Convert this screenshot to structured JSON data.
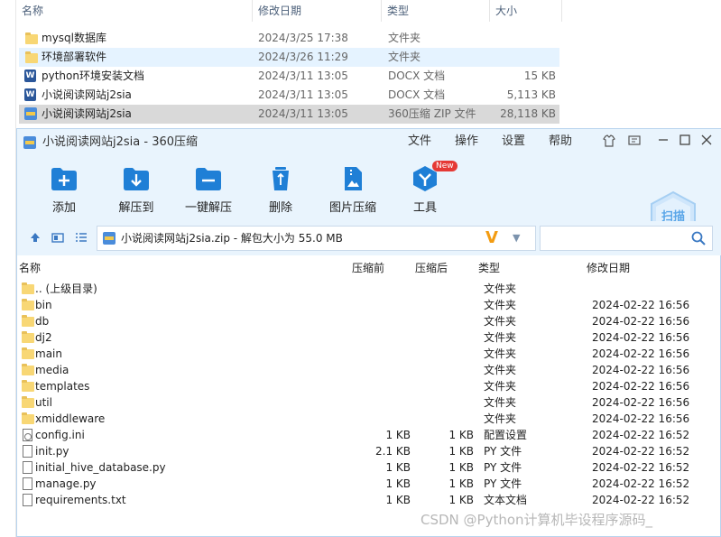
{
  "explorer": {
    "headers": {
      "name": "名称",
      "date": "修改日期",
      "type": "类型",
      "size": "大小"
    },
    "rows": [
      {
        "name": "mysql数据库",
        "date": "2024/3/25 17:38",
        "type": "文件夹",
        "size": "",
        "icon": "folder-icon"
      },
      {
        "name": "环境部署软件",
        "date": "2024/3/26 11:29",
        "type": "文件夹",
        "size": "",
        "icon": "folder-icon"
      },
      {
        "name": "python环境安装文档",
        "date": "2024/3/11 13:05",
        "type": "DOCX 文档",
        "size": "15 KB",
        "icon": "word-doc-icon"
      },
      {
        "name": "小说阅读网站j2sia",
        "date": "2024/3/11 13:05",
        "type": "DOCX 文档",
        "size": "5,113 KB",
        "icon": "word-doc-icon"
      },
      {
        "name": "小说阅读网站j2sia",
        "date": "2024/3/11 13:05",
        "type": "360压缩 ZIP 文件",
        "size": "28,118 KB",
        "icon": "zip-archive-icon"
      }
    ]
  },
  "zipwin": {
    "title": "小说阅读网站j2sia - 360压缩",
    "menu": [
      "文件",
      "操作",
      "设置",
      "帮助"
    ],
    "tools": [
      {
        "label": "添加",
        "icon": "add-folder-icon"
      },
      {
        "label": "解压到",
        "icon": "extract-to-icon"
      },
      {
        "label": "一键解压",
        "icon": "one-click-extract-icon"
      },
      {
        "label": "删除",
        "icon": "recycle-bin-icon"
      },
      {
        "label": "图片压缩",
        "icon": "image-compress-icon"
      },
      {
        "label": "工具",
        "icon": "tools-icon",
        "badge": "New"
      }
    ],
    "scan_label": "扫描",
    "address": "小说阅读网站j2sia.zip - 解包大小为 55.0 MB",
    "search_placeholder": "",
    "columns": {
      "name": "名称",
      "before": "压缩前",
      "after": "压缩后",
      "type": "类型",
      "date": "修改日期"
    },
    "files": [
      {
        "name": ".. (上级目录)",
        "before": "",
        "after": "",
        "type": "文件夹",
        "date": "",
        "icon": "folder-icon"
      },
      {
        "name": "bin",
        "before": "",
        "after": "",
        "type": "文件夹",
        "date": "2024-02-22 16:56",
        "icon": "folder-icon"
      },
      {
        "name": "db",
        "before": "",
        "after": "",
        "type": "文件夹",
        "date": "2024-02-22 16:56",
        "icon": "folder-icon"
      },
      {
        "name": "dj2",
        "before": "",
        "after": "",
        "type": "文件夹",
        "date": "2024-02-22 16:56",
        "icon": "folder-icon"
      },
      {
        "name": "main",
        "before": "",
        "after": "",
        "type": "文件夹",
        "date": "2024-02-22 16:56",
        "icon": "folder-icon"
      },
      {
        "name": "media",
        "before": "",
        "after": "",
        "type": "文件夹",
        "date": "2024-02-22 16:56",
        "icon": "folder-icon"
      },
      {
        "name": "templates",
        "before": "",
        "after": "",
        "type": "文件夹",
        "date": "2024-02-22 16:56",
        "icon": "folder-icon"
      },
      {
        "name": "util",
        "before": "",
        "after": "",
        "type": "文件夹",
        "date": "2024-02-22 16:56",
        "icon": "folder-icon"
      },
      {
        "name": "xmiddleware",
        "before": "",
        "after": "",
        "type": "文件夹",
        "date": "2024-02-22 16:56",
        "icon": "folder-icon"
      },
      {
        "name": "config.ini",
        "before": "1 KB",
        "after": "1 KB",
        "type": "配置设置",
        "date": "2024-02-22 16:52",
        "icon": "config-file-icon"
      },
      {
        "name": "init.py",
        "before": "2.1 KB",
        "after": "1 KB",
        "type": "PY 文件",
        "date": "2024-02-22 16:52",
        "icon": "file-icon"
      },
      {
        "name": "initial_hive_database.py",
        "before": "1 KB",
        "after": "1 KB",
        "type": "PY 文件",
        "date": "2024-02-22 16:52",
        "icon": "file-icon"
      },
      {
        "name": "manage.py",
        "before": "1 KB",
        "after": "1 KB",
        "type": "PY 文件",
        "date": "2024-02-22 16:52",
        "icon": "file-icon"
      },
      {
        "name": "requirements.txt",
        "before": "1 KB",
        "after": "1 KB",
        "type": "文本文档",
        "date": "2024-02-22 16:52",
        "icon": "file-icon"
      }
    ]
  },
  "watermark": "CSDN @Python计算机毕设程序源码_",
  "colors": {
    "accent": "#1f7fd6",
    "window_bg": "#e9f4fd",
    "folder": "#f8d775",
    "badge": "#e53935"
  }
}
